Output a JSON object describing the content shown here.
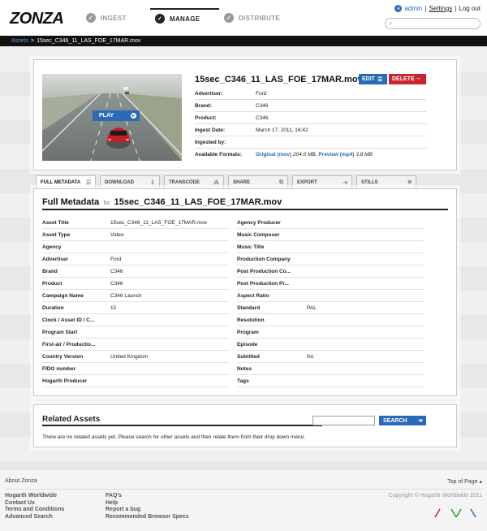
{
  "header": {
    "logo": "ZONZA",
    "nav": [
      {
        "label": "INGEST",
        "icon": "check-icon",
        "active": false
      },
      {
        "label": "MANAGE",
        "icon": "check-icon",
        "active": true
      },
      {
        "label": "DISTRIBUTE",
        "icon": "check-icon",
        "active": false
      }
    ],
    "user": "admin",
    "sep1": "|",
    "settings": "Settings",
    "sep2": "|",
    "logout": "Log out",
    "search_placeholder": ""
  },
  "breadcrumb": {
    "root": "Assets",
    "sep": ">",
    "current": "15sec_C346_11_LAS_FOE_17MAR.mov"
  },
  "asset": {
    "title": "15sec_C346_11_LAS_FOE_17MAR.mov",
    "play_label": "PLAY",
    "edit_label": "EDIT",
    "delete_label": "DELETE",
    "rows": [
      {
        "key": "Advertiser:",
        "value": "Ford"
      },
      {
        "key": "Brand:",
        "value": "C346"
      },
      {
        "key": "Product:",
        "value": "C346"
      },
      {
        "key": "Ingest Date:",
        "value": "March 17, 2011, 16:42"
      },
      {
        "key": "Ingested by:",
        "value": ""
      }
    ],
    "formats_key": "Available Formats:",
    "format1_label": "Original (mov)",
    "format1_size": "204.0 MB,",
    "format2_label": "Preview (mp4)",
    "format2_size": "3.8 MB"
  },
  "tabs": [
    {
      "label": "FULL METADATA",
      "icon": "list-icon",
      "active": true
    },
    {
      "label": "DOWNLOAD",
      "icon": "download-icon",
      "active": false
    },
    {
      "label": "TRANSCODE",
      "icon": "transcode-icon",
      "active": false
    },
    {
      "label": "SHARE",
      "icon": "share-icon",
      "active": false
    },
    {
      "label": "EXPORT",
      "icon": "export-icon",
      "active": false
    },
    {
      "label": "STILLS",
      "icon": "camera-icon",
      "active": false
    }
  ],
  "metadata": {
    "heading": "Full Metadata",
    "for": "for",
    "asset_name": "15sec_C346_11_LAS_FOE_17MAR.mov",
    "left": [
      {
        "key": "Asset Title",
        "value": "15sec_C346_11_LAS_FOE_17MAR.mov"
      },
      {
        "key": "Asset Type",
        "value": "Video"
      },
      {
        "key": "Agency",
        "value": ""
      },
      {
        "key": "Advertiser",
        "value": "Ford"
      },
      {
        "key": "Brand",
        "value": "C346"
      },
      {
        "key": "Product",
        "value": "C346"
      },
      {
        "key": "Campaign Name",
        "value": "C346 Launch"
      },
      {
        "key": "Duration",
        "value": "15"
      },
      {
        "key": "Clock / Asset ID / C...",
        "value": ""
      },
      {
        "key": "Program Start",
        "value": ""
      },
      {
        "key": "First-air / Productio...",
        "value": ""
      },
      {
        "key": "Country Version",
        "value": "United Kingdom"
      },
      {
        "key": "FIDO number",
        "value": ""
      },
      {
        "key": "Hogarth Producer",
        "value": ""
      }
    ],
    "right": [
      {
        "key": "Agency Producer",
        "value": ""
      },
      {
        "key": "Music Composer",
        "value": ""
      },
      {
        "key": "Music Title",
        "value": ""
      },
      {
        "key": "Production Company",
        "value": ""
      },
      {
        "key": "Post Production Co...",
        "value": ""
      },
      {
        "key": "Post Production Pr...",
        "value": ""
      },
      {
        "key": "Aspect Ratio",
        "value": ""
      },
      {
        "key": "Standard",
        "value": "PAL"
      },
      {
        "key": "Resolution",
        "value": ""
      },
      {
        "key": "Program",
        "value": ""
      },
      {
        "key": "Episode",
        "value": ""
      },
      {
        "key": "Subtitled",
        "value": "No"
      },
      {
        "key": "Notes",
        "value": ""
      },
      {
        "key": "Tags",
        "value": ""
      }
    ]
  },
  "related": {
    "title": "Related Assets",
    "search_label": "SEARCH",
    "message": "There are no related assets yet. Please search for other assets and then relate them from their drop down menu."
  },
  "footer": {
    "about": "About Zonza",
    "top_of_page": "Top of Page",
    "col1": [
      "Hogarth Worldwide",
      "Contact Us",
      "Terms and Conditions",
      "Advanced Search"
    ],
    "col2": [
      "FAQ's",
      "Help",
      "Report a bug",
      "Recommended Browser Specs"
    ],
    "copyright": "Copyright © Hogarth Worldwide 2011"
  },
  "colors": {
    "accent_blue": "#2a6ab8",
    "delete_red": "#c8262f",
    "tick_red": "#d0202a",
    "tick_green": "#2e9d3a",
    "tick_blue": "#2a6ab8"
  }
}
